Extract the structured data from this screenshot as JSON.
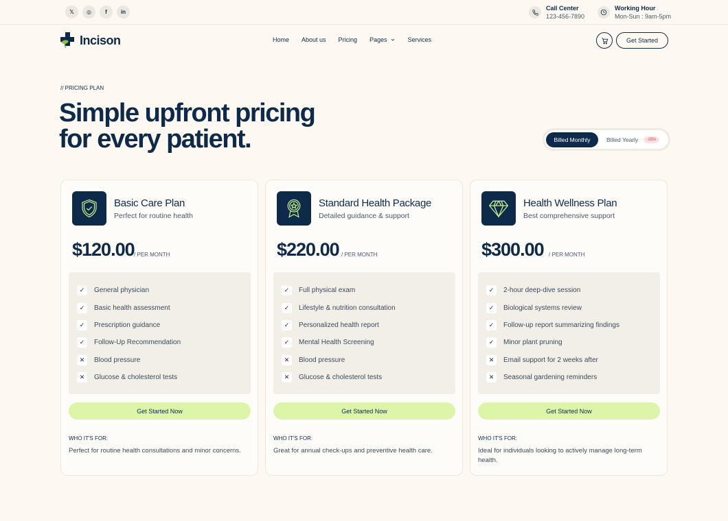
{
  "topbar": {
    "socials": [
      {
        "icon": "x-twitter-icon",
        "glyph": "𝕏"
      },
      {
        "icon": "instagram-icon",
        "glyph": "◎"
      },
      {
        "icon": "facebook-icon",
        "glyph": "f"
      },
      {
        "icon": "linkedin-icon",
        "glyph": "in"
      }
    ],
    "call": {
      "label": "Call Center",
      "value": "123-456-7890"
    },
    "hours": {
      "label": "Working Hour",
      "value": "Mon-Sun : 9am-5pm"
    }
  },
  "brand": {
    "name": "Incison",
    "colors": {
      "primary": "#0d2a4a",
      "accent": "#8cc63f",
      "cta": "#dcf5a8"
    }
  },
  "nav": {
    "items": [
      "Home",
      "About us",
      "Pricing",
      "Pages",
      "Services"
    ],
    "cta": "Get Started"
  },
  "hero": {
    "eyebrow": "// PRICING PLAN",
    "title_line1": "Simple upfront pricing",
    "title_line2": "for every patient."
  },
  "billing": {
    "monthly": "Billed Monthly",
    "yearly": "Billed Yearly",
    "discount": "-15%",
    "selected": "monthly"
  },
  "plans": [
    {
      "icon": "shield-check-icon",
      "name": "Basic Care Plan",
      "subtitle": "Perfect for routine health",
      "price": "$120.00",
      "period": "/ PER MONTH",
      "features": [
        {
          "text": "General physician",
          "included": true
        },
        {
          "text": "Basic health assessment",
          "included": true
        },
        {
          "text": "Prescription guidance",
          "included": true
        },
        {
          "text": "Follow-Up Recommendation",
          "included": true
        },
        {
          "text": "Blood pressure",
          "included": false
        },
        {
          "text": "Glucose & cholesterol tests",
          "included": false
        }
      ],
      "cta": "Get Started Now",
      "who_label": "WHO IT'S FOR:",
      "who_text": "Perfect for routine health consultations and minor concerns."
    },
    {
      "icon": "award-ribbon-icon",
      "name": "Standard Health Package",
      "subtitle": "Detailed guidance & support",
      "price": "$220.00",
      "period": "/ PER MONTH",
      "features": [
        {
          "text": "Full physical exam",
          "included": true
        },
        {
          "text": "Lifestyle & nutrition consultation",
          "included": true
        },
        {
          "text": "Personalized health report",
          "included": true
        },
        {
          "text": "Mental Health Screening",
          "included": true
        },
        {
          "text": "Blood pressure",
          "included": false
        },
        {
          "text": "Glucose & cholesterol tests",
          "included": false
        }
      ],
      "cta": "Get Started Now",
      "who_label": "WHO IT'S FOR:",
      "who_text": "Great for annual check-ups and preventive health care."
    },
    {
      "icon": "diamond-icon",
      "name": "Health Wellness Plan",
      "subtitle": "Best comprehensive support",
      "price": "$300.00",
      "period": "/ PER MONTH",
      "features": [
        {
          "text": "2-hour deep-dive session",
          "included": true
        },
        {
          "text": "Biological systems review",
          "included": true
        },
        {
          "text": "Follow-up report summarizing findings",
          "included": true
        },
        {
          "text": "Minor plant pruning",
          "included": true
        },
        {
          "text": "Email support for 2 weeks after",
          "included": false
        },
        {
          "text": "Seasonal gardening reminders",
          "included": false
        }
      ],
      "cta": "Get Started Now",
      "who_label": "WHO IT'S FOR:",
      "who_text": "Ideal for individuals looking to actively manage long-term health."
    }
  ]
}
